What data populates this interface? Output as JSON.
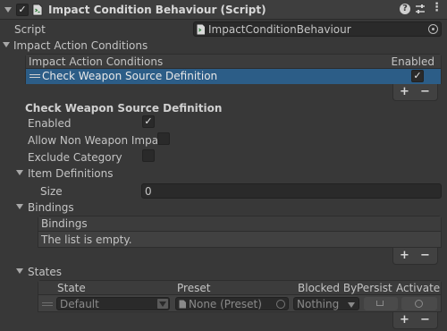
{
  "component": {
    "title": "Impact Condition Behaviour (Script)",
    "enabled": true
  },
  "script_row": {
    "label": "Script",
    "value": "ImpactConditionBehaviour"
  },
  "impact_conditions": {
    "label": "Impact Action Conditions",
    "list_header": "Impact Action Conditions",
    "enabled_header": "Enabled",
    "items": [
      {
        "label": "Check Weapon Source Definition",
        "enabled": true
      }
    ],
    "add": "+",
    "remove": "−"
  },
  "definition": {
    "title": "Check Weapon Source Definition",
    "enabled_label": "Enabled",
    "enabled": true,
    "allow_non_weapon_label": "Allow Non Weapon Impact",
    "allow_non_weapon": false,
    "exclude_category_label": "Exclude Category",
    "exclude_category": false
  },
  "item_definitions": {
    "label": "Item Definitions",
    "size_label": "Size",
    "size_value": "0"
  },
  "bindings": {
    "label": "Bindings",
    "list_header": "Bindings",
    "empty_text": "The list is empty.",
    "add": "+",
    "remove": "−"
  },
  "states": {
    "label": "States",
    "columns": {
      "state": "State",
      "preset": "Preset",
      "blocked_by": "Blocked By",
      "persist": "Persist",
      "activate": "Activate"
    },
    "row": {
      "state": "Default",
      "preset": "None (Preset)",
      "blocked_by": "Nothing"
    },
    "add": "+",
    "remove": "−"
  },
  "colors": {
    "background": "#383838",
    "selection": "#2c5d87",
    "field": "#2a2a2a"
  }
}
